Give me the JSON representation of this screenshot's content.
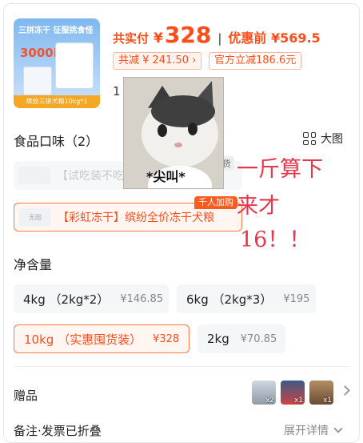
{
  "product": {
    "thumb_title": "三拼冻干 征服挑食怪",
    "thumb_big": "3000IU",
    "thumb_footer": "缤纷三拼犬粮10kg*1"
  },
  "price": {
    "total_label": "共实付",
    "currency": "¥",
    "amount": "328",
    "separator": "|",
    "pre_discount": "优惠前 ¥569.5",
    "saved_tag": "共减 ¥ 241.50 ›",
    "direct_cut_tag": "官方立减186.6元"
  },
  "quantity_value": "1",
  "flavor": {
    "title": "食品口味（2）",
    "view_label": "大图",
    "options": [
      {
        "label": "【试吃装不吃包退】",
        "thumb": "",
        "badge": "缺货"
      },
      {
        "label": "【彩虹冻干】缤纷全价冻干犬粮",
        "thumb": "无图",
        "badge": "千人加购"
      }
    ]
  },
  "weight": {
    "title": "净含量",
    "options": [
      {
        "label": "4kg （2kg*2）",
        "price": "¥146.85"
      },
      {
        "label": "6kg （2kg*3）",
        "price": "¥195"
      },
      {
        "label": "10kg （实惠囤货装）",
        "price": "¥328"
      },
      {
        "label": "2kg",
        "price": "¥70.85"
      }
    ]
  },
  "gifts": {
    "label": "赠品",
    "items": [
      {
        "qty": "x2"
      },
      {
        "qty": "x1"
      },
      {
        "qty": "x1"
      }
    ]
  },
  "notes": {
    "label": "备注·发票已折叠",
    "expand_label": "展开详情"
  },
  "overlay": {
    "meme_caption": "*尖叫*",
    "handwriting": [
      "一斤算下",
      "来才",
      "16！！"
    ]
  },
  "colors": {
    "accent": "#ff4d1a",
    "handwriting": "#e8374d"
  }
}
